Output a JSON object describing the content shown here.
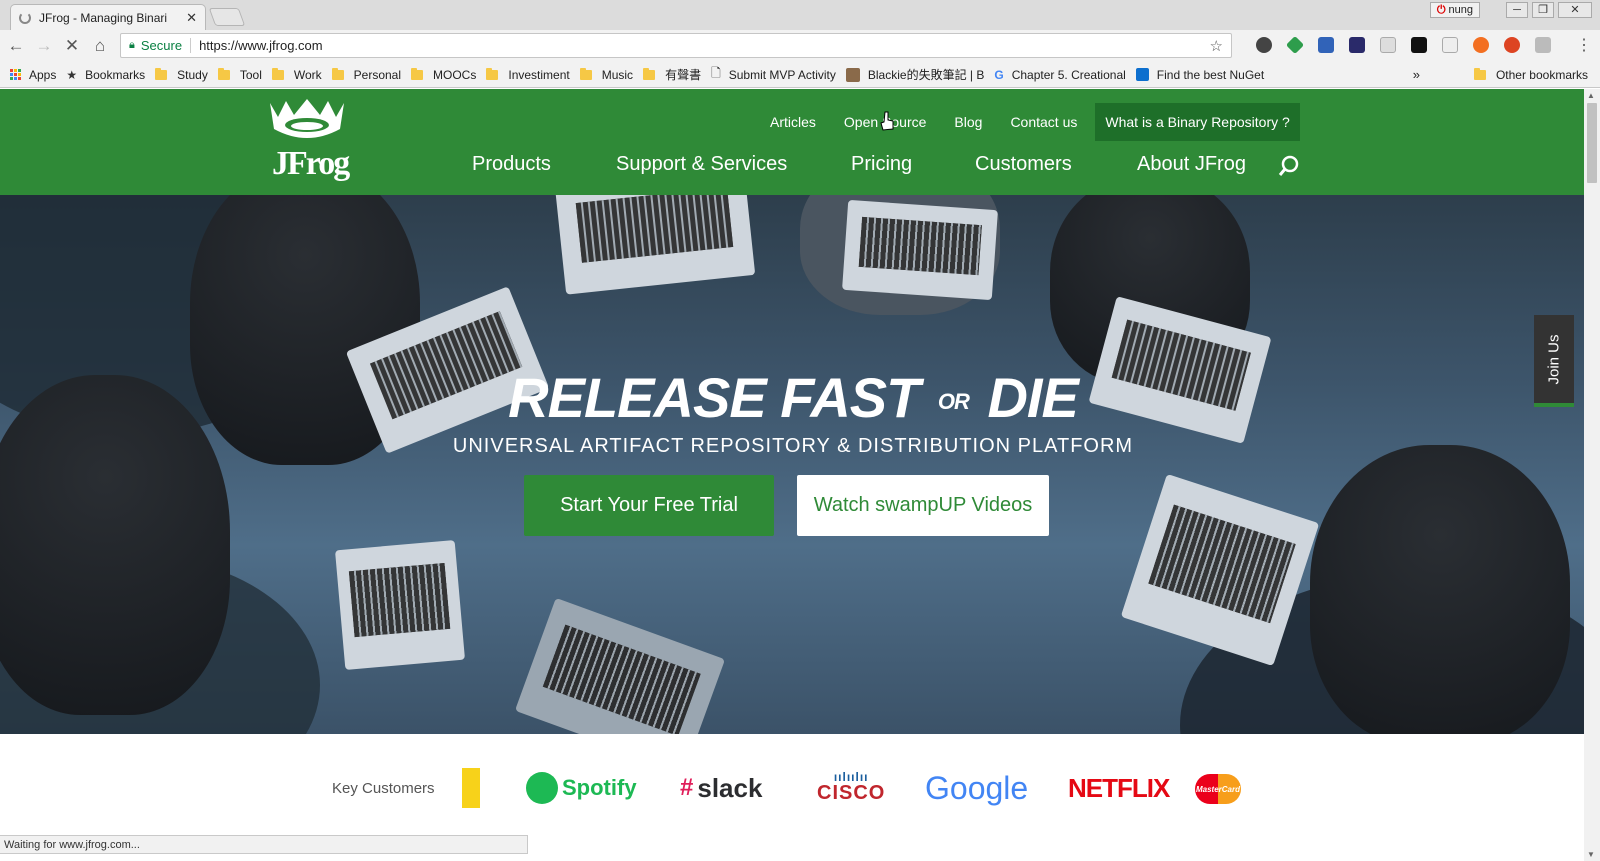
{
  "browser": {
    "tab_title": "JFrog - Managing Binari",
    "close_label": "✕",
    "user": "nung",
    "url": "https://www.jfrog.com",
    "secure_label": "Secure",
    "status_text": "Waiting for www.jfrog.com..."
  },
  "bookmarks": {
    "items": [
      "Apps",
      "Bookmarks",
      "Study",
      "Tool",
      "Work",
      "Personal",
      "MOOCs",
      "Investiment",
      "Music",
      "有聲書",
      "Submit MVP Activity",
      "Blackie的失敗筆記 | B",
      "Chapter 5. Creational",
      "Find the best NuGet"
    ],
    "overflow": "»",
    "other": "Other bookmarks"
  },
  "site": {
    "logo_text": "JFrog",
    "top_nav": [
      "Articles",
      "Open Source",
      "Blog",
      "Contact us",
      "What is a Binary Repository ?"
    ],
    "main_nav": [
      "Products",
      "Support & Services",
      "Pricing",
      "Customers",
      "About JFrog"
    ],
    "hero": {
      "title_a": "RELEASE FAST",
      "title_or": "OR",
      "title_b": "DIE",
      "subtitle": "UNIVERSAL ARTIFACT REPOSITORY & DISTRIBUTION PLATFORM",
      "cta_primary": "Start Your Free Trial",
      "cta_secondary": "Watch swampUP Videos"
    },
    "join_label": "Join Us",
    "customers_label": "Key Customers",
    "customer_logos": [
      "Spotify",
      "slack",
      "CISCO",
      "Google",
      "NETFLIX",
      "MasterCard"
    ]
  },
  "colors": {
    "brand_green": "#2f8a37",
    "brand_green_dark": "#1e6f29"
  }
}
